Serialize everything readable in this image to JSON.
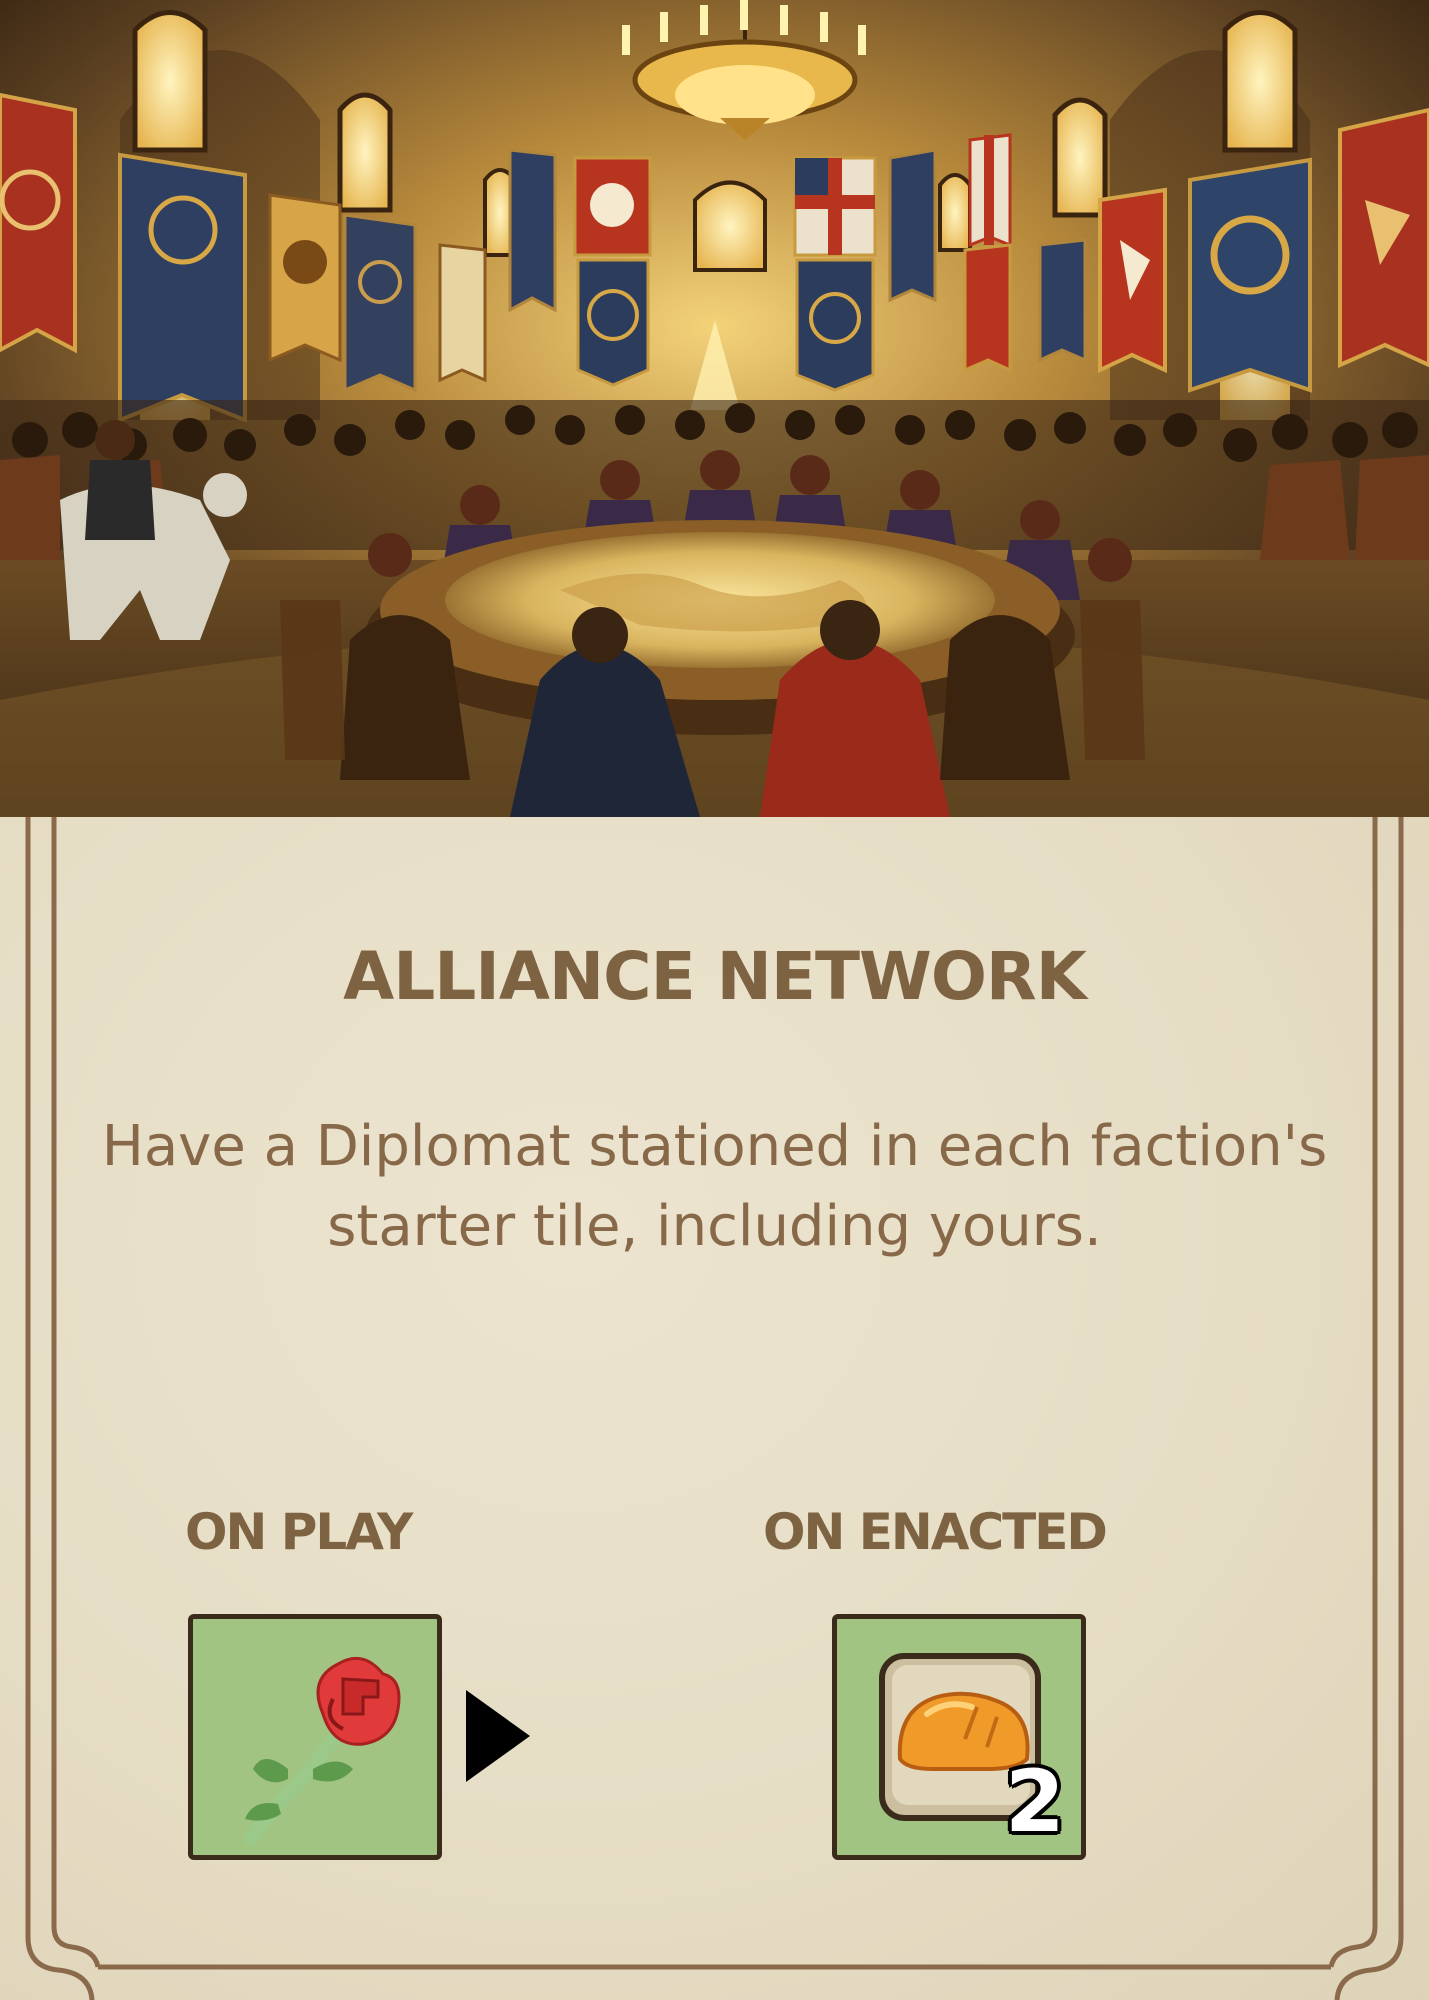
{
  "card": {
    "title": "ALLIANCE NETWORK",
    "description": "Have a Diplomat stationed in each faction's starter tile, including yours.",
    "on_play": {
      "label": "ON PLAY",
      "icon": "rose-icon",
      "arrow_icon": "play-arrow-icon"
    },
    "on_enacted": {
      "label": "ON ENACTED",
      "icon": "bread-icon",
      "count": "2"
    }
  },
  "colors": {
    "parchment": "#e9e1cb",
    "text": "#7e6343",
    "tile_green": "#a1c483",
    "tile_border": "#3b2b1a",
    "frame": "#8a6a4a"
  },
  "illustration": "medieval-council-hall"
}
